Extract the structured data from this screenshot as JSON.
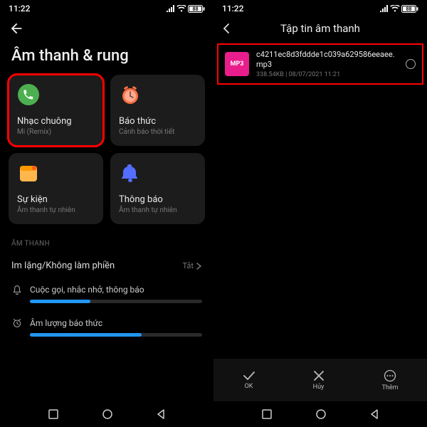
{
  "status": {
    "time": "11:22",
    "battery": "88"
  },
  "screen1": {
    "title": "Âm thanh & rung",
    "cards": [
      {
        "title": "Nhạc chuông",
        "sub": "Mi (Remix)"
      },
      {
        "title": "Báo thức",
        "sub": "Cảnh báo thời tiết"
      },
      {
        "title": "Sự kiện",
        "sub": "Âm thanh tự nhiên"
      },
      {
        "title": "Thông báo",
        "sub": "Âm thanh tự nhiên"
      }
    ],
    "section_label": "ÂM THANH",
    "dnd": {
      "label": "Im lặng/Không làm phiền",
      "value": "Tắt"
    },
    "sliders": [
      {
        "label": "Cuộc gọi, nhắc nhở, thông báo",
        "pct": 35
      },
      {
        "label": "Âm lượng báo thức",
        "pct": 65
      }
    ]
  },
  "screen2": {
    "title": "Tập tin âm thanh",
    "file": {
      "badge": "MP3",
      "name": "c4211ec8d3fddde1c039a629586eeaee.mp3",
      "size": "338.54KB",
      "date": "08/07/2021 11:21"
    },
    "actions": {
      "ok": "OK",
      "cancel": "Hủy",
      "more": "Thêm"
    }
  }
}
